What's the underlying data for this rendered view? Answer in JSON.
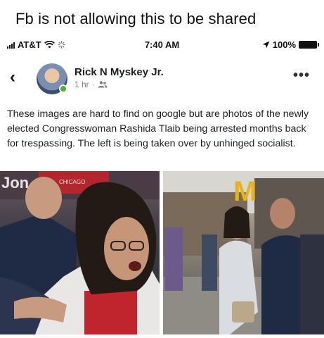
{
  "caption": "Fb is not allowing this to be shared",
  "status_bar": {
    "carrier": "AT&T",
    "time": "7:40 AM",
    "battery": "100%",
    "icons": [
      "signal-icon",
      "wifi-icon",
      "loading-icon",
      "location-arrow-icon",
      "battery-icon"
    ]
  },
  "post": {
    "author": "Rick N Myskey Jr.",
    "time": "1 hr",
    "separator": "·",
    "more": "•••",
    "body": "These images are hard to find on google but are photos of the newly elected Congresswoman Rashida Tlaib being arrested months back for trespassing. The left is being taken over by unhinged socialist.",
    "photos": [
      {
        "sign_text": "Jon",
        "banner_text": "CHICAGO"
      },
      {
        "sign_text": "M"
      }
    ]
  },
  "colors": {
    "online": "#42b72a",
    "text": "#1c1e21",
    "meta": "#7a7d82",
    "police_uniform": "#1f2b44",
    "sign_red": "#b3262d",
    "mcdonalds_yellow": "#e7b21c"
  }
}
